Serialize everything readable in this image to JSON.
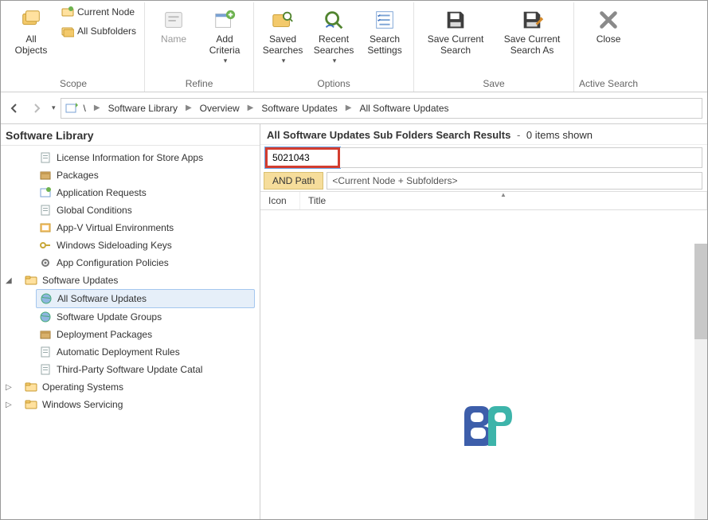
{
  "ribbon": {
    "scope": {
      "group_label": "Scope",
      "all_objects": "All\nObjects",
      "current_node": "Current Node",
      "all_subfolders": "All Subfolders"
    },
    "refine": {
      "group_label": "Refine",
      "name": "Name",
      "add_criteria": "Add\nCriteria"
    },
    "options": {
      "group_label": "Options",
      "saved_searches": "Saved\nSearches",
      "recent_searches": "Recent\nSearches",
      "search_settings": "Search\nSettings"
    },
    "save": {
      "group_label": "Save",
      "save_current_search": "Save Current\nSearch",
      "save_current_search_as": "Save Current\nSearch As"
    },
    "close": {
      "group_label": "Active Search",
      "close": "Close"
    }
  },
  "breadcrumb": {
    "items": [
      "Software Library",
      "Overview",
      "Software Updates",
      "All Software Updates"
    ]
  },
  "sidebar": {
    "title": "Software Library",
    "items": [
      {
        "label": "License Information for Store Apps",
        "level": 2,
        "icon": "doc"
      },
      {
        "label": "Packages",
        "level": 2,
        "icon": "box"
      },
      {
        "label": "Application Requests",
        "level": 2,
        "icon": "app"
      },
      {
        "label": "Global Conditions",
        "level": 2,
        "icon": "doc"
      },
      {
        "label": "App-V Virtual Environments",
        "level": 2,
        "icon": "env"
      },
      {
        "label": "Windows Sideloading Keys",
        "level": 2,
        "icon": "key"
      },
      {
        "label": "App Configuration Policies",
        "level": 2,
        "icon": "gear"
      },
      {
        "label": "Software Updates",
        "level": 1,
        "icon": "folder",
        "expand": "down"
      },
      {
        "label": "All Software Updates",
        "level": 2,
        "icon": "globe",
        "selected": true
      },
      {
        "label": "Software Update Groups",
        "level": 2,
        "icon": "globe"
      },
      {
        "label": "Deployment Packages",
        "level": 2,
        "icon": "box"
      },
      {
        "label": "Automatic Deployment Rules",
        "level": 2,
        "icon": "doc"
      },
      {
        "label": "Third-Party Software Update Catal",
        "level": 2,
        "icon": "doc"
      },
      {
        "label": "Operating Systems",
        "level": 1,
        "icon": "folder",
        "expand": "right"
      },
      {
        "label": "Windows Servicing",
        "level": 1,
        "icon": "folder",
        "expand": "right"
      }
    ]
  },
  "content": {
    "header_strong": "All Software Updates Sub Folders Search Results",
    "header_count": "0 items shown",
    "search_value": "5021043",
    "criteria_label": "AND Path",
    "criteria_value": "<Current Node + Subfolders>",
    "columns": {
      "icon": "Icon",
      "title": "Title"
    }
  }
}
